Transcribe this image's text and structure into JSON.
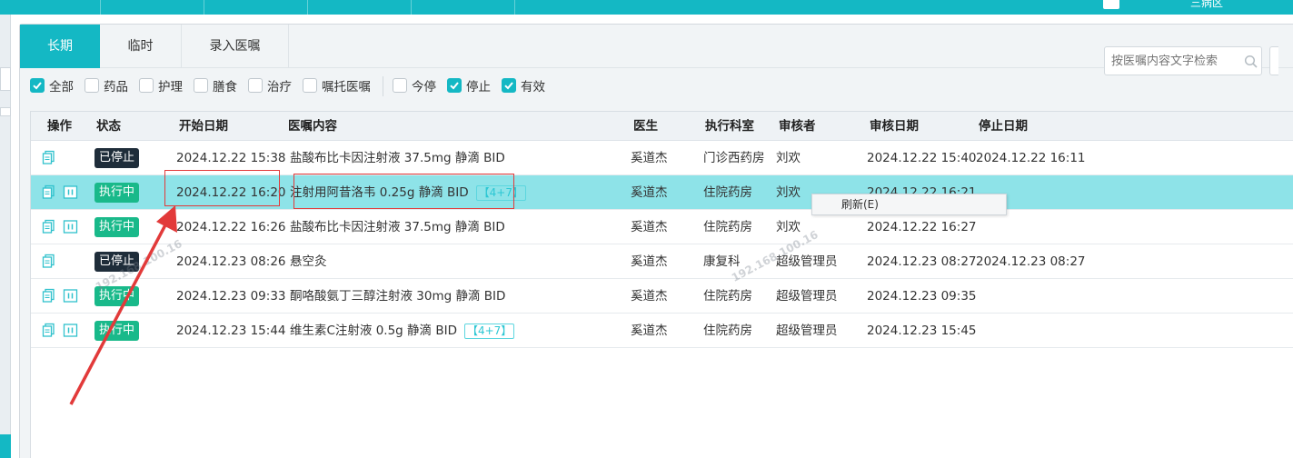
{
  "topbar": {
    "right_fragment": "三病区"
  },
  "tabs": [
    {
      "label": "长期",
      "active": true
    },
    {
      "label": "临时",
      "active": false
    },
    {
      "label": "录入医嘱",
      "active": false
    }
  ],
  "filters": [
    {
      "label": "全部",
      "checked": true
    },
    {
      "label": "药品",
      "checked": false
    },
    {
      "label": "护理",
      "checked": false
    },
    {
      "label": "膳食",
      "checked": false
    },
    {
      "label": "治疗",
      "checked": false
    },
    {
      "label": "嘱托医嘱",
      "checked": false
    },
    {
      "label": "今停",
      "checked": false
    },
    {
      "label": "停止",
      "checked": true
    },
    {
      "label": "有效",
      "checked": true
    }
  ],
  "search": {
    "placeholder": "按医嘱内容文字检索"
  },
  "columns": {
    "op": "操作",
    "status": "状态",
    "start": "开始日期",
    "content": "医嘱内容",
    "doctor": "医生",
    "dept": "执行科室",
    "reviewer": "审核者",
    "review_date": "审核日期",
    "stop_date": "停止日期"
  },
  "rows": [
    {
      "status": "已停止",
      "status_kind": "stopped",
      "start": "2024.12.22 15:38",
      "content": "盐酸布比卡因注射液 37.5mg 静滴 BID",
      "freq": "",
      "doctor": "奚道杰",
      "dept": "门诊西药房",
      "reviewer": "刘欢",
      "review_date": "2024.12.22 15:40",
      "stop_date": "2024.12.22 16:11",
      "has_pause": false,
      "selected": false
    },
    {
      "status": "执行中",
      "status_kind": "running",
      "start": "2024.12.22 16:20",
      "content": "注射用阿昔洛韦 0.25g 静滴 BID",
      "freq": "【4+7】",
      "doctor": "奚道杰",
      "dept": "住院药房",
      "reviewer": "刘欢",
      "review_date": "2024.12.22 16:21",
      "stop_date": "",
      "has_pause": true,
      "selected": true
    },
    {
      "status": "执行中",
      "status_kind": "running",
      "start": "2024.12.22 16:26",
      "content": "盐酸布比卡因注射液 37.5mg 静滴 BID",
      "freq": "",
      "doctor": "奚道杰",
      "dept": "住院药房",
      "reviewer": "刘欢",
      "review_date": "2024.12.22 16:27",
      "stop_date": "",
      "has_pause": true,
      "selected": false
    },
    {
      "status": "已停止",
      "status_kind": "stopped",
      "start": "2024.12.23 08:26",
      "content": "悬空灸",
      "freq": "",
      "doctor": "奚道杰",
      "dept": "康复科",
      "reviewer": "超级管理员",
      "review_date": "2024.12.23 08:27",
      "stop_date": "2024.12.23 08:27",
      "has_pause": false,
      "selected": false
    },
    {
      "status": "执行中",
      "status_kind": "running",
      "start": "2024.12.23 09:33",
      "content": "酮咯酸氨丁三醇注射液 30mg 静滴 BID",
      "freq": "",
      "doctor": "奚道杰",
      "dept": "住院药房",
      "reviewer": "超级管理员",
      "review_date": "2024.12.23 09:35",
      "stop_date": "",
      "has_pause": true,
      "selected": false
    },
    {
      "status": "执行中",
      "status_kind": "running",
      "start": "2024.12.23 15:44",
      "content": "维生素C注射液 0.5g 静滴 BID",
      "freq": "【4+7】",
      "doctor": "奚道杰",
      "dept": "住院药房",
      "reviewer": "超级管理员",
      "review_date": "2024.12.23 15:45",
      "stop_date": "",
      "has_pause": true,
      "selected": false
    }
  ],
  "context_menu": {
    "refresh": "刷新(E)"
  },
  "watermarks": [
    "192.168.100.16",
    "192.168.100.16"
  ],
  "colors": {
    "accent": "#14b8c4",
    "selected_row": "#8ee3e8",
    "running": "#19b98a",
    "stopped": "#1f2d3a",
    "annotation": "#e23a3a"
  }
}
